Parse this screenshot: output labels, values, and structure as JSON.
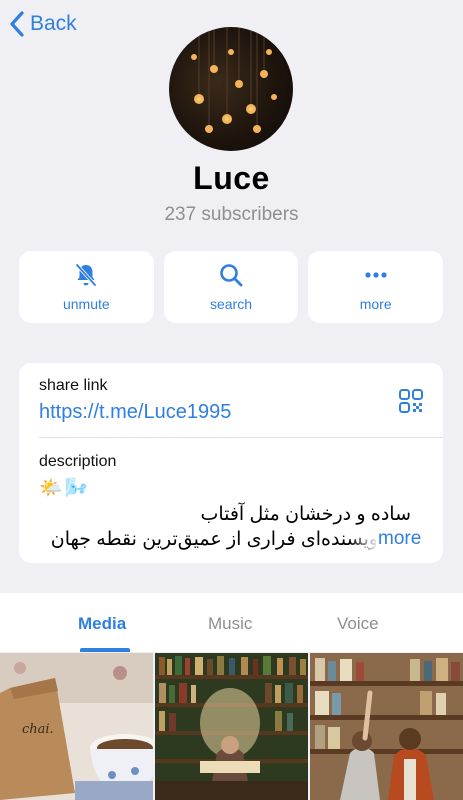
{
  "nav": {
    "back_label": "Back"
  },
  "channel": {
    "name": "Luce",
    "subscribers": "237 subscribers"
  },
  "actions": [
    {
      "label": "unmute",
      "icon": "muted-bell-icon"
    },
    {
      "label": "search",
      "icon": "search-icon"
    },
    {
      "label": "more",
      "icon": "more-dots-icon"
    }
  ],
  "info": {
    "share_link_label": "share link",
    "share_link": "https://t.me/Luce1995",
    "description_label": "description",
    "description_emojis": "🌤️🌬️",
    "description_line1": "ساده و درخشان مثل آفتاب",
    "description_line2": "نویسنده‌ای فراری از عمیق‌ترین نقطه جهان",
    "more_label": "more"
  },
  "tabs": [
    {
      "label": "Media",
      "active": true
    },
    {
      "label": "Music",
      "active": false
    },
    {
      "label": "Voice",
      "active": false
    }
  ],
  "media": [
    {
      "kind": "coffee-cup-photo"
    },
    {
      "kind": "library-photo"
    },
    {
      "kind": "bookshelf-photo"
    }
  ],
  "colors": {
    "accent": "#2f7fe0",
    "background": "#efeff4",
    "muted": "#8e8e93"
  }
}
